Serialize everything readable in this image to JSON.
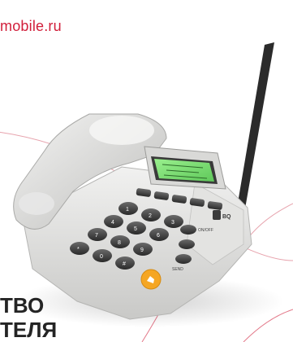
{
  "brand": {
    "url": "mobile.ru",
    "accent_color": "#d11e3a"
  },
  "headline": {
    "line1": "ТВО",
    "line2": "ТЕЛЯ"
  },
  "phone": {
    "keypad": {
      "keys": [
        "1",
        "2",
        "3",
        "4",
        "5",
        "6",
        "7",
        "8",
        "9",
        "*",
        "0",
        "#"
      ]
    },
    "side_labels": {
      "on_off": "ON/OFF",
      "send": "SEND"
    },
    "logo": "BQ",
    "screen_color": "#7fe07a",
    "call_button_color": "#f5a623"
  }
}
